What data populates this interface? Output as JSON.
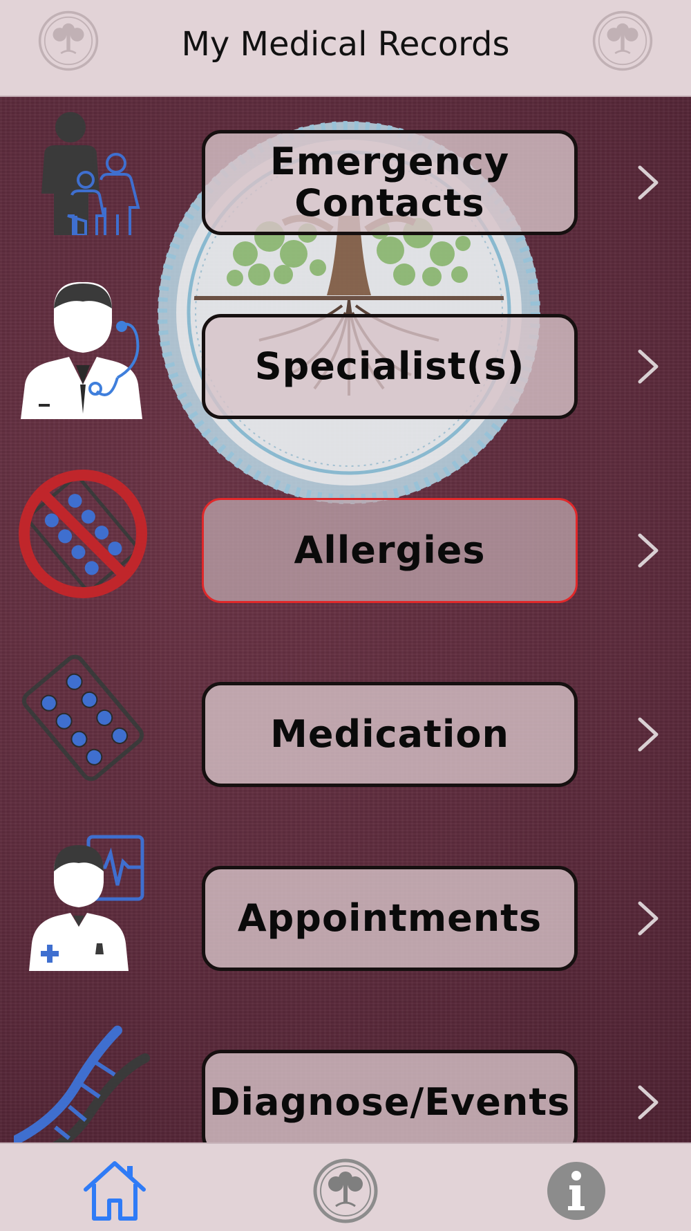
{
  "app": {
    "title": "My Medical Records",
    "accent_color": "#2f7bf6",
    "header_background": "#e2d3d7",
    "page_background": "#5a2a3a"
  },
  "menu": {
    "items": [
      {
        "label": "Emergency Contacts",
        "icon": "family-contacts-icon"
      },
      {
        "label": "Specialist(s)",
        "icon": "doctor-stethoscope-icon"
      },
      {
        "label": "Allergies",
        "icon": "no-pills-icon",
        "selected": true
      },
      {
        "label": "Medication",
        "icon": "pill-blister-icon"
      },
      {
        "label": "Appointments",
        "icon": "doctor-heartbeat-icon"
      },
      {
        "label": "Diagnose/Events",
        "icon": "dna-icon"
      }
    ],
    "chevron_icon": "chevron-right-icon"
  },
  "tabbar": {
    "tabs": [
      {
        "name": "home",
        "icon": "home-icon",
        "active": true
      },
      {
        "name": "tree-logo",
        "icon": "tree-logo-icon"
      },
      {
        "name": "info",
        "icon": "info-icon"
      }
    ]
  }
}
